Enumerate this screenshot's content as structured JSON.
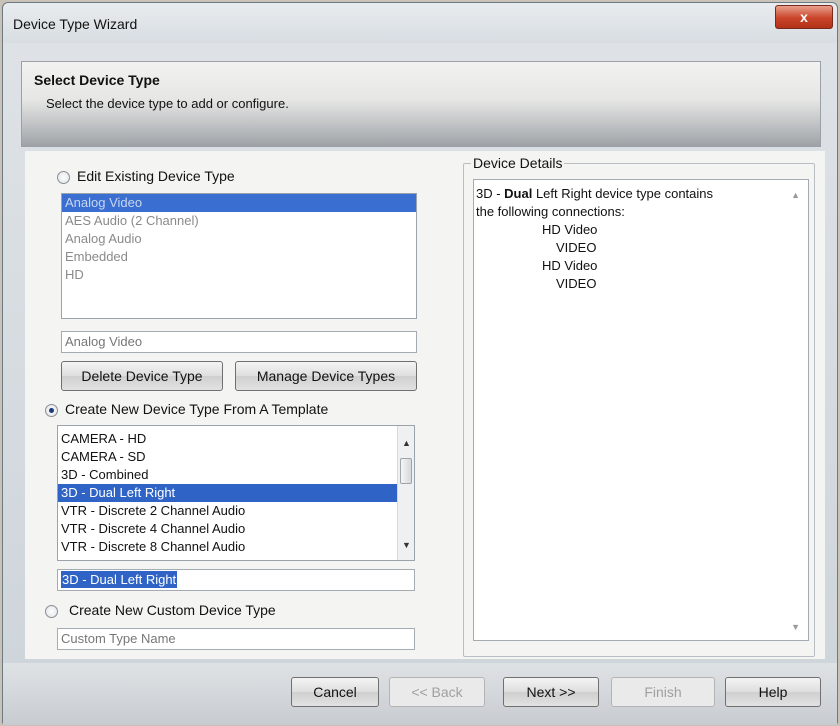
{
  "window": {
    "title": "Device Type Wizard",
    "close_label": "x"
  },
  "header": {
    "title": "Select Device Type",
    "subtitle": "Select the device type to add or configure."
  },
  "edit_existing": {
    "radio_label": "Edit Existing Device Type",
    "checked": false,
    "items": [
      "Analog Video",
      "AES Audio (2 Channel)",
      "Analog Audio",
      "Embedded",
      "HD"
    ],
    "selected_value": "Analog Video",
    "delete_button": "Delete Device Type",
    "manage_button": "Manage Device Types"
  },
  "create_from_template": {
    "radio_label": "Create New Device Type From A Template",
    "checked": true,
    "items": [
      "CAMERA - HD",
      "CAMERA - SD",
      "3D - Combined",
      "3D - Dual Left Right",
      "VTR - Discrete 2 Channel Audio",
      "VTR - Discrete 4 Channel Audio",
      "VTR - Discrete 8 Channel Audio"
    ],
    "selected_index": 3,
    "selected_value": "3D - Dual Left Right"
  },
  "create_custom": {
    "radio_label": "Create New Custom Device Type",
    "checked": false,
    "placeholder": "Custom Type Name"
  },
  "device_details": {
    "legend": "Device Details",
    "line1_prefix": "3D - ",
    "line1_bold": "Dual",
    "line1_suffix": " Left Right device type contains",
    "line2": "the following connections:",
    "connections": [
      "HD Video",
      "VIDEO",
      "HD Video",
      "VIDEO"
    ]
  },
  "footer": {
    "cancel": "Cancel",
    "back": "<< Back",
    "next": "Next >>",
    "finish": "Finish",
    "help": "Help"
  },
  "colors": {
    "selection": "#2f64c6",
    "close_button": "#c9442a"
  }
}
